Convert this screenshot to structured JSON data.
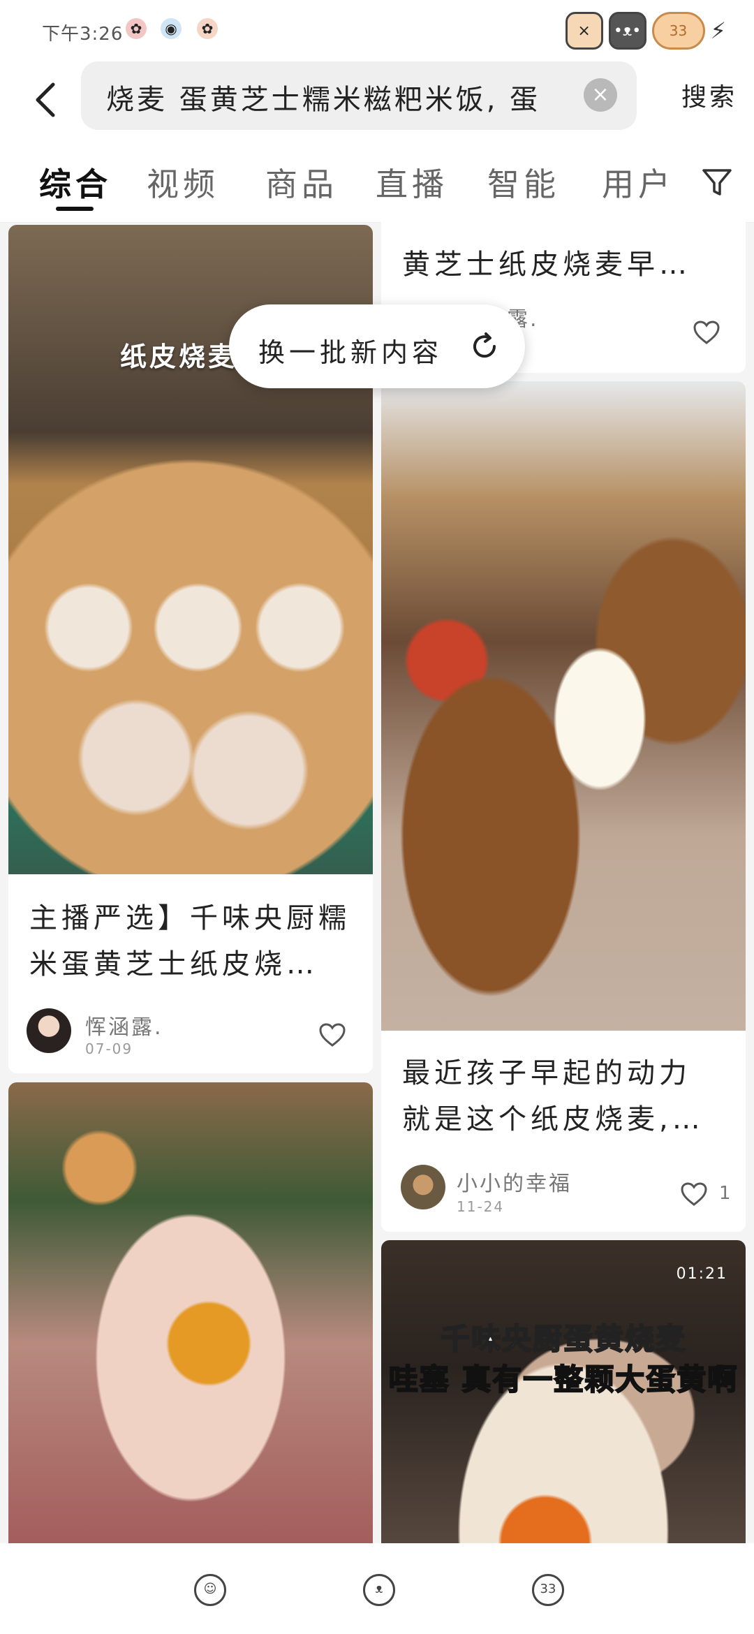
{
  "status": {
    "time": "下午3:26",
    "right_icons": [
      "cat-sticker-icon",
      "cat-sticker-icon",
      "fish-sticker-icon",
      "charging-icon"
    ]
  },
  "search": {
    "query": "烧麦 蛋黄芝士糯米糍粑米饭, 蛋",
    "search_label": "搜索"
  },
  "tabs": [
    {
      "label": "综合",
      "active": true
    },
    {
      "label": "视频"
    },
    {
      "label": "商品"
    },
    {
      "label": "直播"
    },
    {
      "label": "智能"
    },
    {
      "label": "用户"
    }
  ],
  "toast": {
    "text": "换一批新内容"
  },
  "cards": {
    "left1": {
      "image_caption": "纸皮烧麦",
      "title_line1": "主播严选】千味央厨糯",
      "title_line2": "米蛋黄芝士纸皮烧…",
      "author": "恽涵露.",
      "date": "07-09"
    },
    "right_top": {
      "title_line1": "黄芝士纸皮烧麦早…",
      "author_partial": "露."
    },
    "right2": {
      "title_line1": "最近孩子早起的动力",
      "title_line2": "就是这个纸皮烧麦,…",
      "author": "小小的幸福",
      "date": "11-24",
      "likes": "1"
    },
    "right3": {
      "duration": "01:21",
      "overlay_line1": "千味央厨蛋黄烧麦",
      "overlay_line2": "哇塞 真有一整颗大蛋黄啊"
    }
  },
  "colors": {
    "accent": "#111111",
    "overlay_green": "#1fc51f",
    "background": "#f4f4f4"
  }
}
